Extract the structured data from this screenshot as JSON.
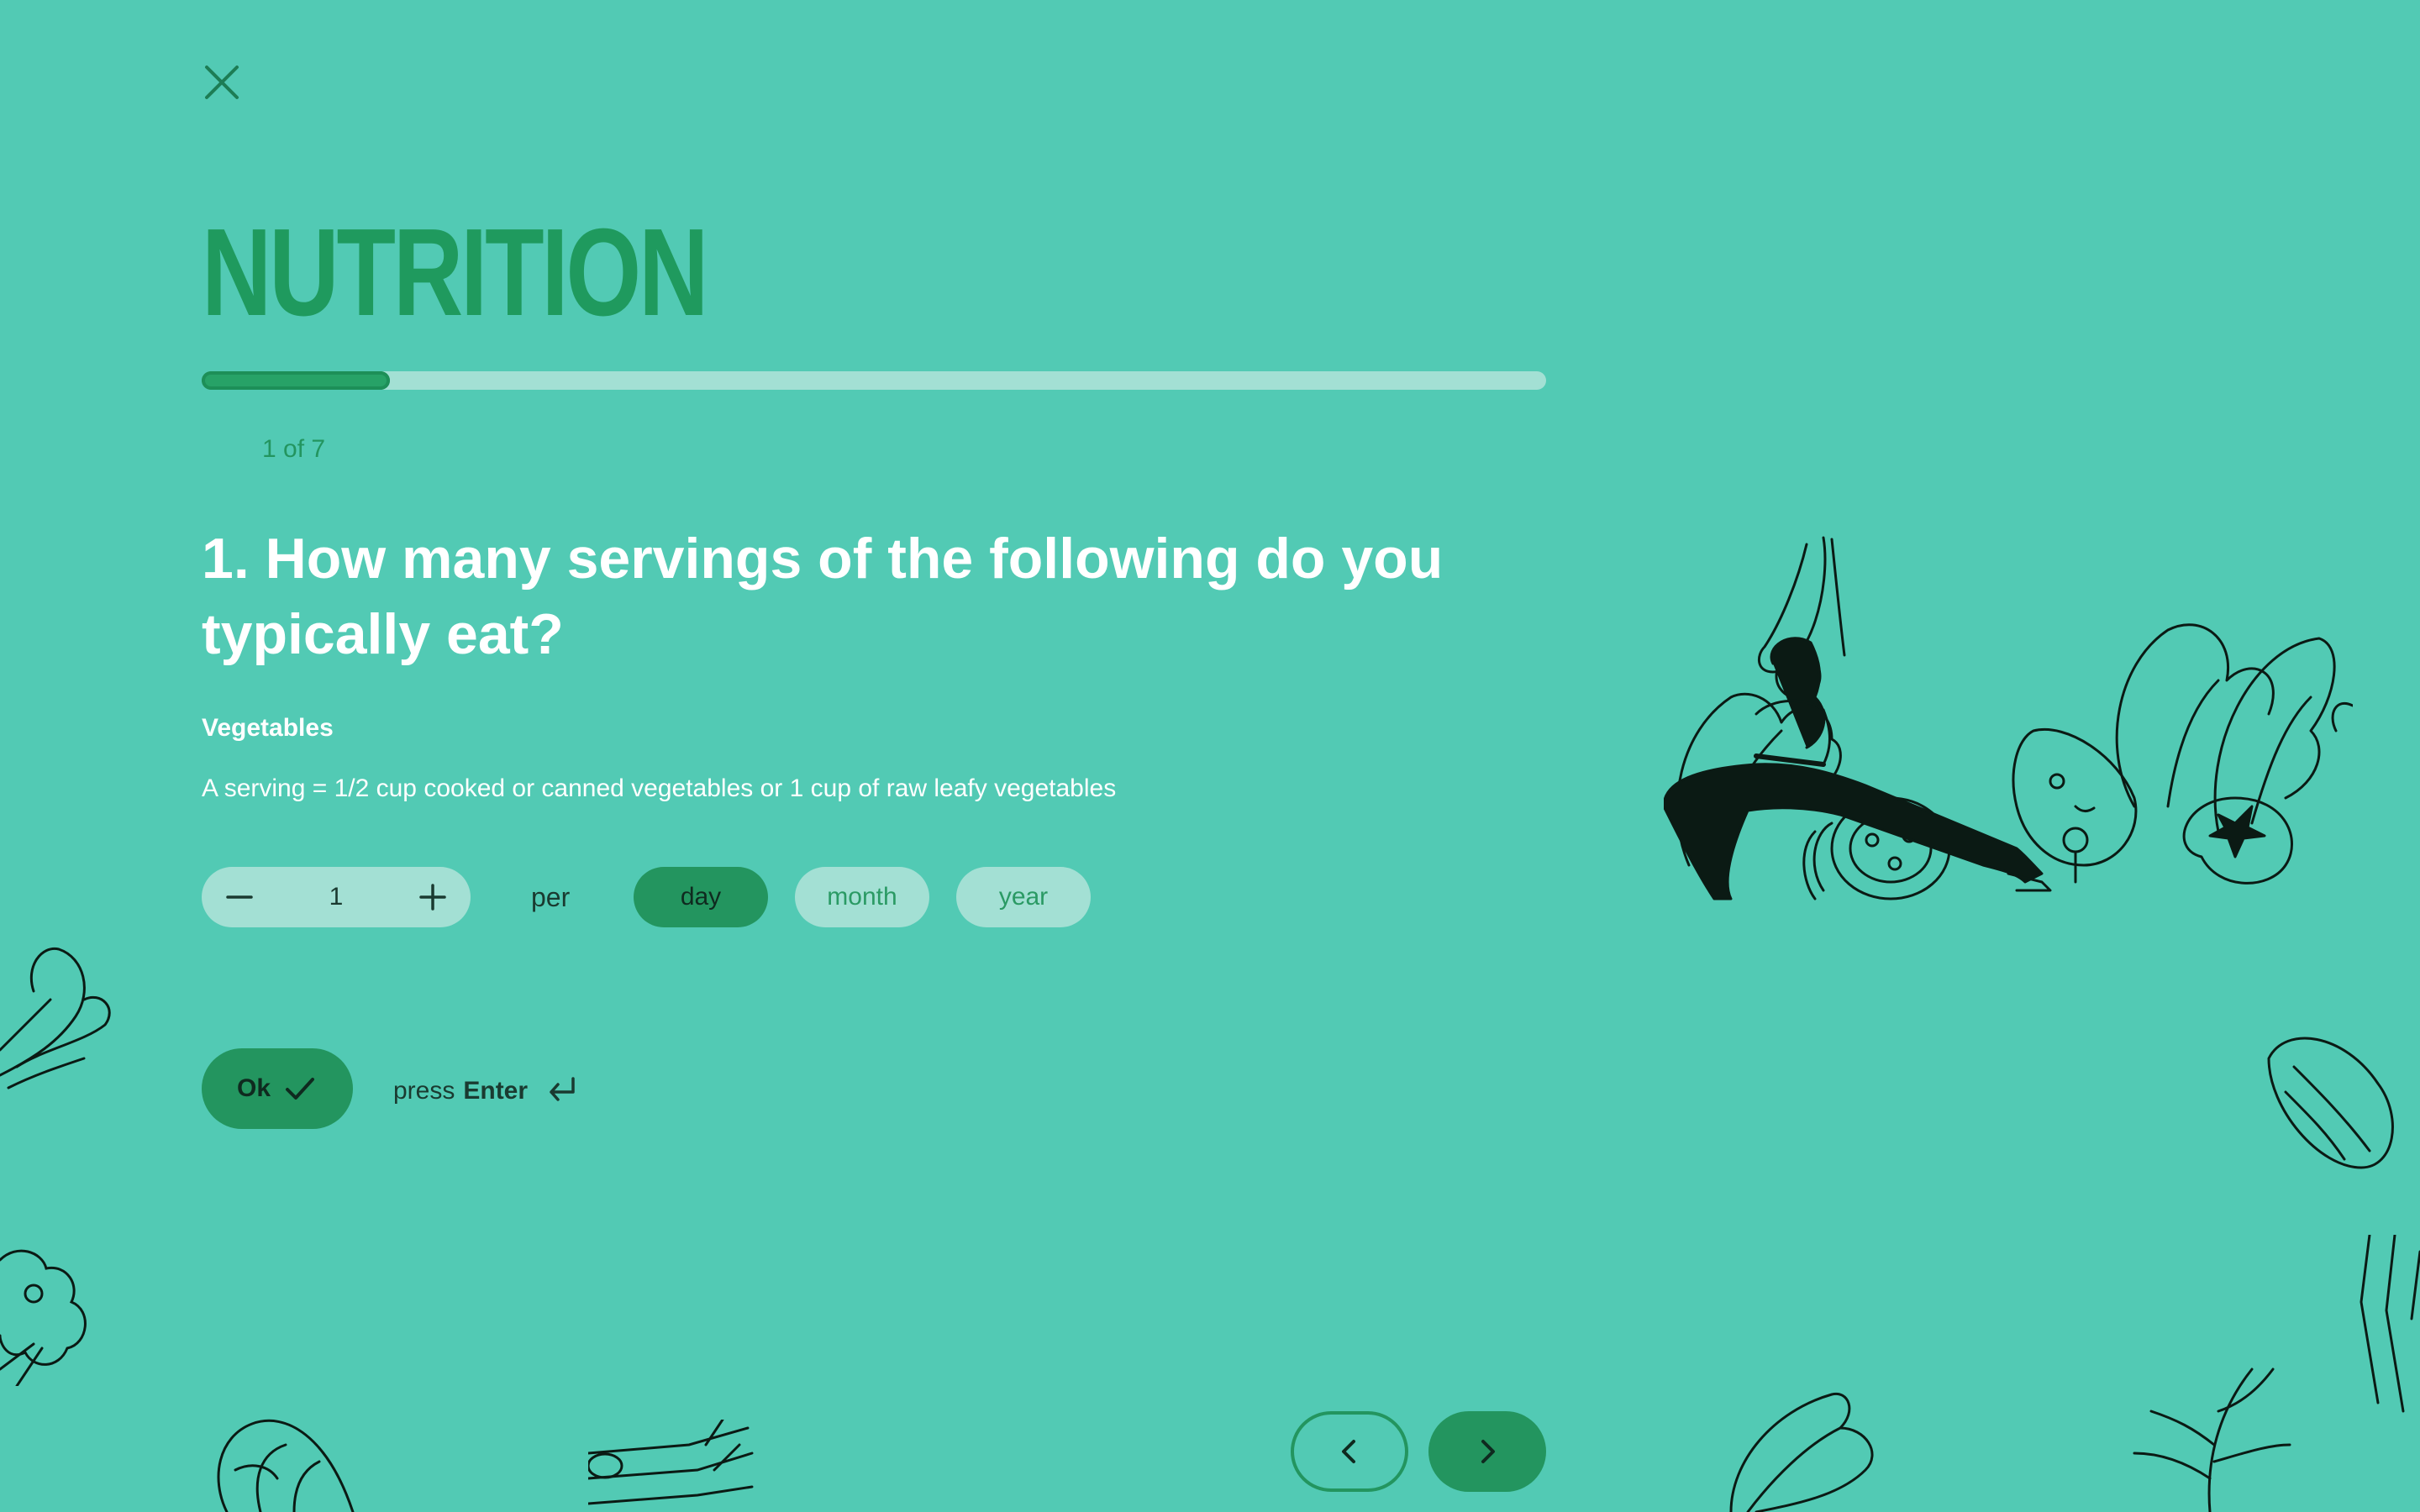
{
  "header": {
    "close_icon": "close-icon"
  },
  "section": {
    "title": "NUTRITION"
  },
  "progress": {
    "current": 1,
    "total": 7,
    "fraction": 0.14,
    "label": "1 of 7"
  },
  "question": {
    "text": "1. How many servings of the following do you typically eat?",
    "item_label": "Vegetables",
    "item_description": "A serving = 1/2 cup cooked or canned vegetables or 1 cup of raw leafy vegetables"
  },
  "stepper": {
    "value": "1",
    "minus_icon": "minus-icon",
    "plus_icon": "plus-icon"
  },
  "per_label": "per",
  "units": [
    {
      "label": "day",
      "selected": true
    },
    {
      "label": "month",
      "selected": false
    },
    {
      "label": "year",
      "selected": false
    }
  ],
  "submit": {
    "ok_label": "Ok",
    "press_label": "press",
    "enter_label": "Enter"
  },
  "nav": {
    "prev_icon": "chevron-left-icon",
    "next_icon": "chevron-right-icon"
  },
  "colors": {
    "background": "#52cab4",
    "accent": "#23955f",
    "pill": "#a3e0d4",
    "title": "#1f9a5e"
  }
}
